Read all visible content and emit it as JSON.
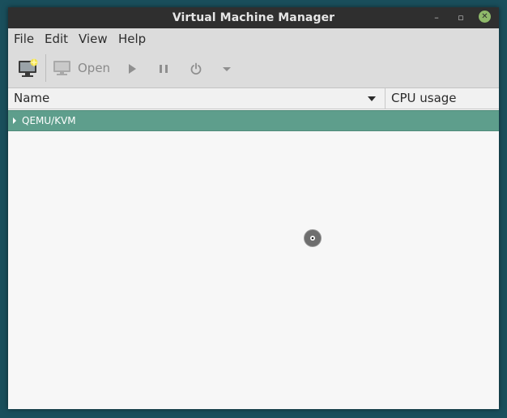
{
  "window": {
    "title": "Virtual Machine Manager",
    "controls": {
      "minimize": "–",
      "maximize": "▫",
      "close": "✕"
    }
  },
  "menu": {
    "items": [
      {
        "label": "File"
      },
      {
        "label": "Edit"
      },
      {
        "label": "View"
      },
      {
        "label": "Help"
      }
    ]
  },
  "toolbar": {
    "new_vm_icon": "monitor-sparkle-icon",
    "open_label": "Open",
    "open_icon": "monitor-icon",
    "run_icon": "play-icon",
    "pause_icon": "pause-icon",
    "shutdown_icon": "power-icon",
    "shutdown_menu_icon": "dropdown-arrow-icon"
  },
  "table": {
    "columns": [
      {
        "label": "Name"
      },
      {
        "label": "CPU usage"
      }
    ],
    "rows": [
      {
        "label": "QEMU/KVM",
        "selected": true
      }
    ]
  },
  "colors": {
    "titlebar": "#2f2f2f",
    "toolbar": "#dcdcdc",
    "selection": "#5e9e8c",
    "close_button": "#8fb96a",
    "desktop": "#1a4f5c"
  }
}
